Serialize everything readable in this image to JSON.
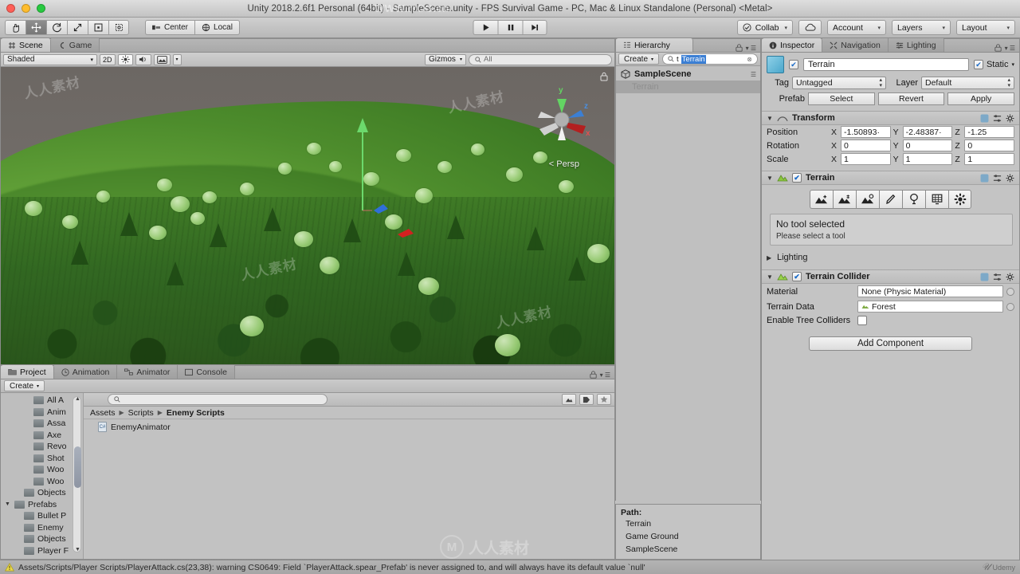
{
  "window": {
    "title": "Unity 2018.2.6f1 Personal (64bit) - SampleScene.unity - FPS Survival Game - PC, Mac & Linux Standalone (Personal) <Metal>",
    "watermark_top": "WWW.rrCG.cn",
    "watermark_center": "人人素材",
    "watermark_udemy": "Udemy"
  },
  "toolbar": {
    "transform_tools": [
      {
        "name": "hand-tool",
        "icon": "hand",
        "active": false
      },
      {
        "name": "move-tool",
        "icon": "move",
        "active": true
      },
      {
        "name": "rotate-tool",
        "icon": "rotate",
        "active": false
      },
      {
        "name": "scale-tool",
        "icon": "scale",
        "active": false
      },
      {
        "name": "rect-tool",
        "icon": "rect",
        "active": false
      },
      {
        "name": "transform-tool",
        "icon": "transform",
        "active": false
      }
    ],
    "pivot_label": "Center",
    "space_label": "Local",
    "play_label": "play",
    "pause_label": "pause",
    "step_label": "step",
    "collab_label": "Collab",
    "cloud_label": "cloud-icon",
    "account_label": "Account",
    "layers_label": "Layers",
    "layout_label": "Layout"
  },
  "scene": {
    "tabs": [
      {
        "label": "Scene",
        "icon": "grid-icon",
        "active": true
      },
      {
        "label": "Game",
        "icon": "gamepad-icon",
        "active": false
      }
    ],
    "draw_mode": "Shaded",
    "mode_2d": "2D",
    "lighting_toggle": "light-icon",
    "audio_toggle": "audio-icon",
    "fx_toggle": "fx-icon",
    "gizmos_label": "Gizmos",
    "search_placeholder": "All",
    "persp_label": "Persp",
    "axis_x": "x",
    "axis_y": "y",
    "axis_z": "z"
  },
  "hierarchy": {
    "tab_label": "Hierarchy",
    "create_label": "Create",
    "search_prefix": "t ",
    "search_value": "Terrain",
    "items": [
      {
        "label": "SampleScene",
        "type": "scene",
        "selected": false
      },
      {
        "label": "Terrain",
        "type": "gameobject",
        "selected": true
      }
    ],
    "path_title": "Path:",
    "path_items": [
      "Terrain",
      "Game Ground",
      "SampleScene"
    ]
  },
  "project": {
    "tabs": [
      {
        "label": "Project",
        "icon": "folder-icon",
        "active": true
      },
      {
        "label": "Animation",
        "icon": "clock-icon",
        "active": false
      },
      {
        "label": "Animator",
        "icon": "animator-icon",
        "active": false
      },
      {
        "label": "Console",
        "icon": "console-icon",
        "active": false
      }
    ],
    "create_label": "Create",
    "search_placeholder": "",
    "tree": [
      {
        "label": "All A",
        "depth": 2,
        "twisty": ""
      },
      {
        "label": "Anim",
        "depth": 2,
        "twisty": ""
      },
      {
        "label": "Assa",
        "depth": 2,
        "twisty": ""
      },
      {
        "label": "Axe",
        "depth": 2,
        "twisty": ""
      },
      {
        "label": "Revo",
        "depth": 2,
        "twisty": ""
      },
      {
        "label": "Shot",
        "depth": 2,
        "twisty": ""
      },
      {
        "label": "Woo",
        "depth": 2,
        "twisty": ""
      },
      {
        "label": "Woo",
        "depth": 2,
        "twisty": ""
      },
      {
        "label": "Objects",
        "depth": 1,
        "twisty": ""
      },
      {
        "label": "Prefabs",
        "depth": 0,
        "twisty": "▼"
      },
      {
        "label": "Bullet P",
        "depth": 1,
        "twisty": ""
      },
      {
        "label": "Enemy",
        "depth": 1,
        "twisty": ""
      },
      {
        "label": "Objects",
        "depth": 1,
        "twisty": ""
      },
      {
        "label": "Player F",
        "depth": 1,
        "twisty": ""
      }
    ],
    "breadcrumb": [
      "Assets",
      "Scripts",
      "Enemy Scripts"
    ],
    "assets": [
      {
        "label": "EnemyAnimator",
        "type": "script"
      }
    ]
  },
  "inspector": {
    "tabs": [
      {
        "label": "Inspector",
        "icon": "info-icon",
        "active": true
      },
      {
        "label": "Navigation",
        "icon": "nav-icon",
        "active": false
      },
      {
        "label": "Lighting",
        "icon": "lighting-icon",
        "active": false
      }
    ],
    "object_name": "Terrain",
    "object_enabled": true,
    "static_label": "Static",
    "static_checked": true,
    "tag_label": "Tag",
    "tag_value": "Untagged",
    "layer_label": "Layer",
    "layer_value": "Default",
    "prefab_label": "Prefab",
    "prefab_buttons": [
      "Select",
      "Revert",
      "Apply"
    ],
    "transform": {
      "title": "Transform",
      "rows": [
        {
          "label": "Position",
          "x": "-1.50893·",
          "y": "-2.48387·",
          "z": "-1.25"
        },
        {
          "label": "Rotation",
          "x": "0",
          "y": "0",
          "z": "0"
        },
        {
          "label": "Scale",
          "x": "1",
          "y": "1",
          "z": "1"
        }
      ]
    },
    "terrain": {
      "title": "Terrain",
      "enabled": true,
      "tools": [
        "raise-lower-terrain-icon",
        "paint-height-icon",
        "smooth-height-icon",
        "paint-texture-icon",
        "place-trees-icon",
        "paint-details-icon",
        "terrain-settings-icon"
      ],
      "help_title": "No tool selected",
      "help_body": "Please select a tool",
      "lighting_foldout": "Lighting"
    },
    "terrain_collider": {
      "title": "Terrain Collider",
      "enabled": true,
      "material_label": "Material",
      "material_value": "None (Physic Material)",
      "terrain_data_label": "Terrain Data",
      "terrain_data_value": "Forest",
      "tree_colliders_label": "Enable Tree Colliders",
      "tree_colliders_checked": false
    },
    "add_component_label": "Add Component"
  },
  "status": {
    "message": "Assets/Scripts/Player Scripts/PlayerAttack.cs(23,38): warning CS0649: Field `PlayerAttack.spear_Prefab' is never assigned to, and will always have its default value `null'",
    "icon": "warning-icon"
  },
  "colors": {
    "accent_blue": "#3b7fd4",
    "panel_bg": "#c4c4c4",
    "toolbar_bg": "#c3c3c3",
    "terrain_green": "#6ead3f",
    "sky": "#6e6a66"
  }
}
